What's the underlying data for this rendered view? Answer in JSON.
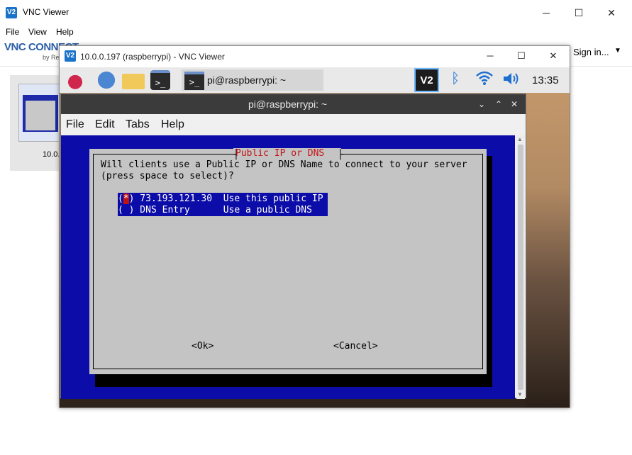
{
  "outer": {
    "title": "VNC Viewer",
    "logo": "V2",
    "menu": [
      "File",
      "View",
      "Help"
    ],
    "brand": "VNC CONNECT",
    "brand_by": "by Re",
    "sign_in": "Sign in...",
    "thumb_label": "10.0."
  },
  "inner": {
    "title": "10.0.0.197 (raspberrypi) - VNC Viewer",
    "logo": "V2"
  },
  "taskbar": {
    "terminal_glyph": ">_",
    "task_label": "pi@raspberrypi: ~",
    "vnc_tray": "V2",
    "clock": "13:35"
  },
  "terminal": {
    "title": "pi@raspberrypi: ~",
    "menu": [
      "File",
      "Edit",
      "Tabs",
      "Help"
    ]
  },
  "dialog": {
    "title": "Public IP or DNS",
    "line1": "Will clients use a Public IP or DNS Name to connect to your server",
    "line2": "(press space to select)?",
    "options": [
      {
        "text": "(*) 73.193.121.30  Use this public IP",
        "selected": true
      },
      {
        "text": "( ) DNS Entry      Use a public DNS",
        "selected": false
      }
    ],
    "ok": "<Ok>",
    "cancel": "<Cancel>"
  },
  "icons": {
    "minimize": "─",
    "maximize": "☐",
    "close": "✕",
    "bluetooth": "ᛒ",
    "wifi": "📶",
    "volume": "🔊"
  }
}
